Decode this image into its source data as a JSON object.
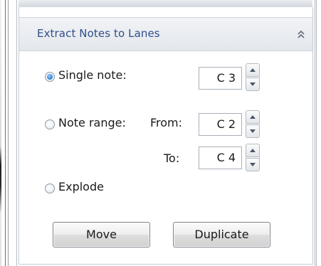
{
  "panel": {
    "title": "Extract Notes to Lanes",
    "collapse_icon": "double-chevron-up-icon"
  },
  "options": {
    "single_note": {
      "label": "Single note:",
      "checked": true,
      "value": "C 3"
    },
    "note_range": {
      "label": "Note range:",
      "checked": false,
      "from_label": "From:",
      "from_value": "C 2",
      "to_label": "To:",
      "to_value": "C 4"
    },
    "explode": {
      "label": "Explode",
      "checked": false
    }
  },
  "buttons": {
    "move": "Move",
    "duplicate": "Duplicate"
  },
  "colors": {
    "title_text": "#2f4f8a",
    "header_bg": "#e7eaee",
    "radio_checked": "#3d8ee0"
  }
}
